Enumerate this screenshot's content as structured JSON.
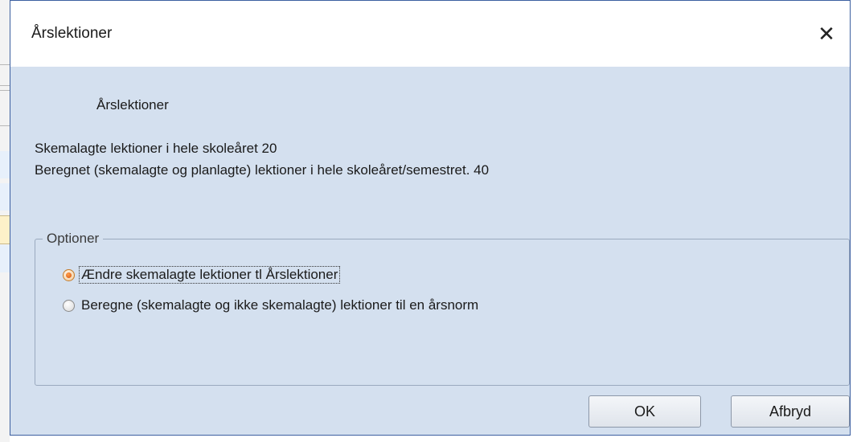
{
  "dialog": {
    "title": "Årslektioner",
    "close_glyph": "✕",
    "heading": "Årslektioner",
    "info_scheduled": "Skemalagte lektioner i hele skoleåret 20",
    "info_calculated": "Beregnet (skemalagte og planlagte) lektioner i hele skoleåret/semestret. 40"
  },
  "options": {
    "group_label": "Optioner",
    "items": [
      {
        "label": "Ændre skemalagte lektioner tl Årslektioner",
        "checked": true
      },
      {
        "label": "Beregne (skemalagte og ikke skemalagte) lektioner til en årsnorm",
        "checked": false
      }
    ]
  },
  "buttons": {
    "ok": "OK",
    "cancel": "Afbryd"
  },
  "colors": {
    "dialog_bg": "#d4e0ef",
    "border_accent": "#3c5fa0",
    "radio_selected": "#d4500c"
  },
  "icons": {
    "close": "close-icon"
  }
}
